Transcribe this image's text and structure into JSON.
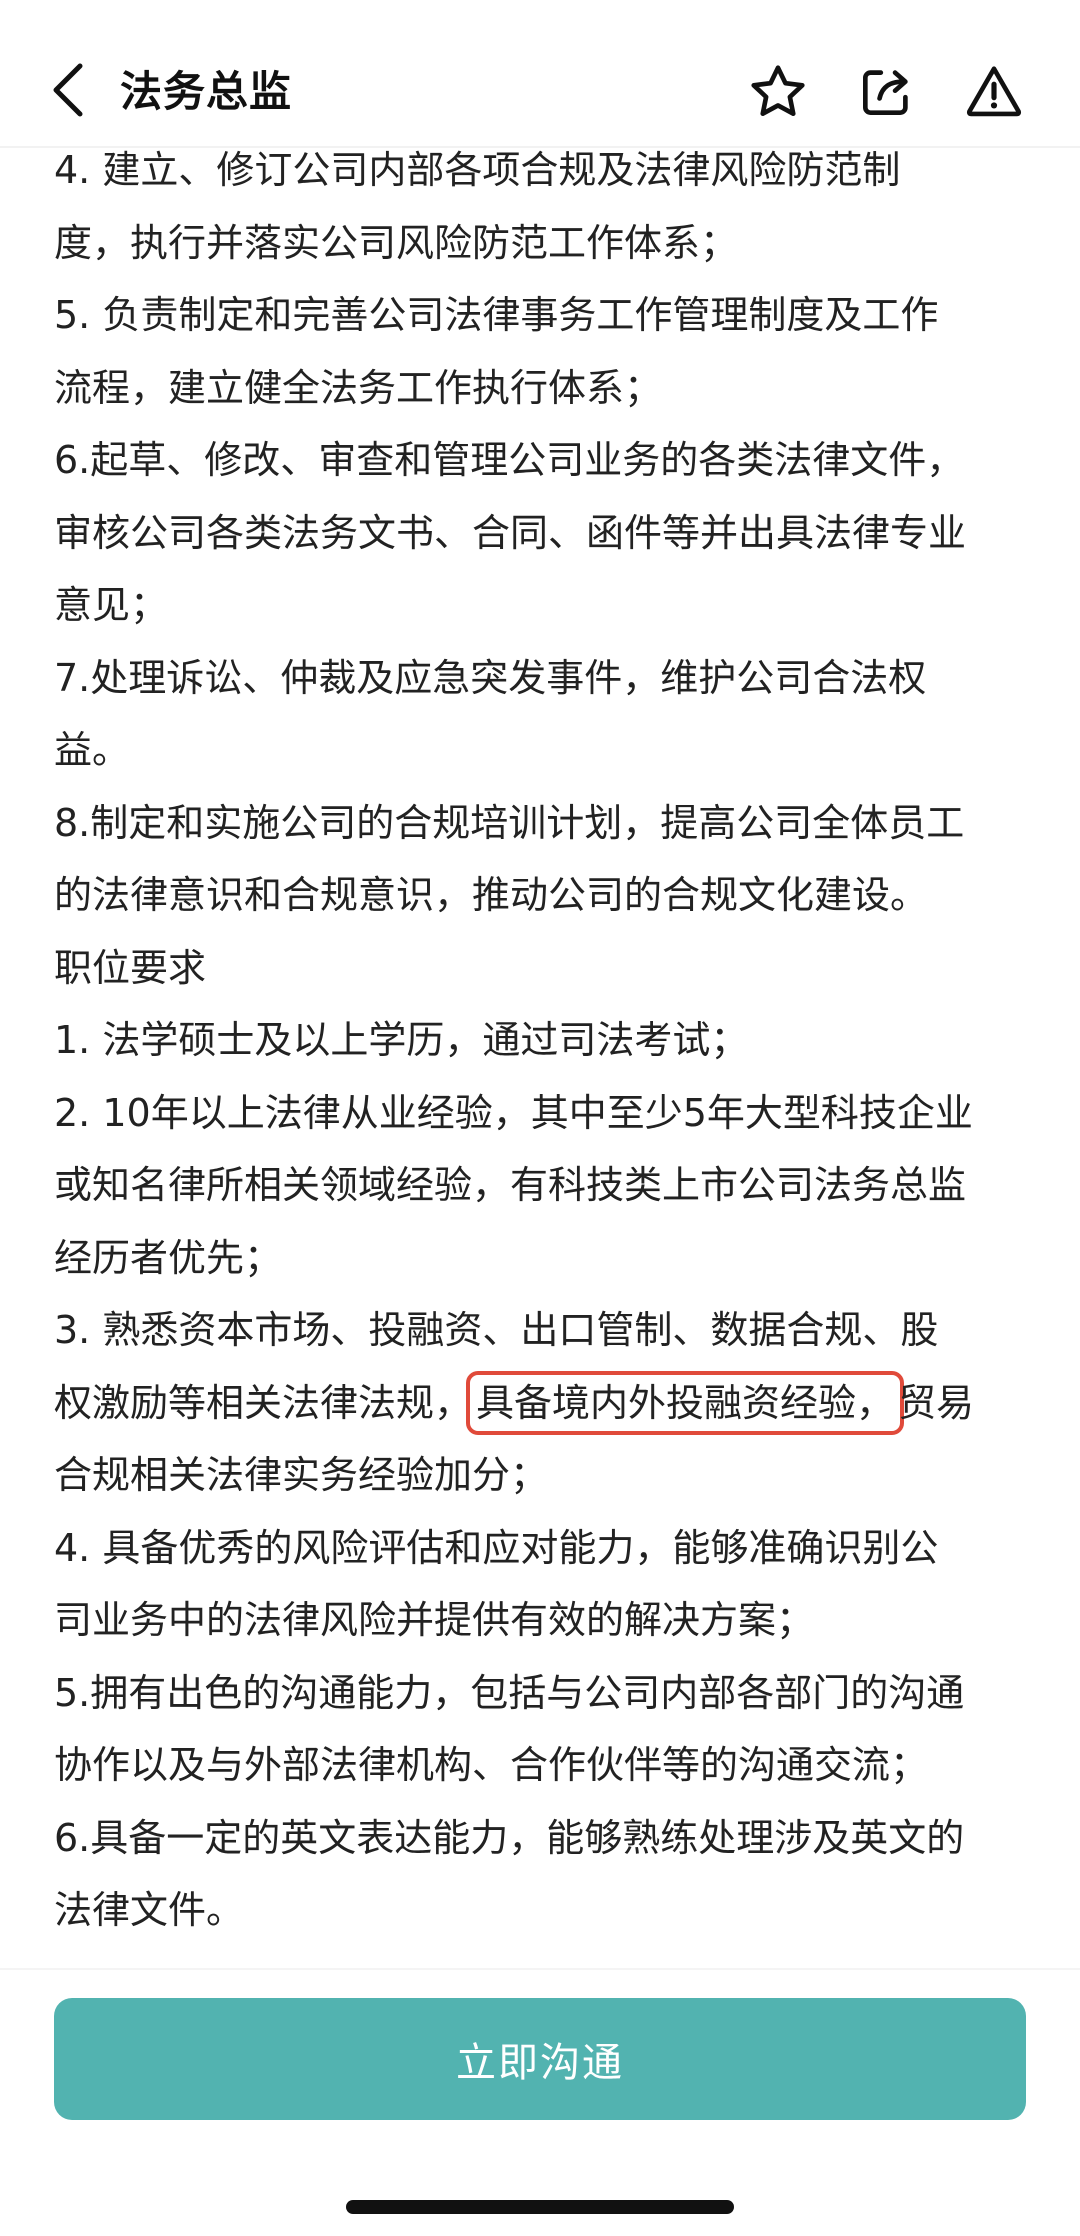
{
  "header": {
    "title": "法务总监",
    "back_icon": "chevron-left-icon",
    "actions": [
      "star-icon",
      "share-icon",
      "report-icon"
    ]
  },
  "content": {
    "lines": [
      "4. 建立、修订公司内部各项合规及法律风险防范制",
      "度，执行并落实公司风险防范工作体系；",
      "5. 负责制定和完善公司法律事务工作管理制度及工作",
      "流程，建立健全法务工作执行体系；",
      "6.起草、修改、审查和管理公司业务的各类法律文件，",
      "审核公司各类法务文书、合同、函件等并出具法律专业",
      "意见；",
      "7.处理诉讼、仲裁及应急突发事件，维护公司合法权",
      "益。",
      "8.制定和实施公司的合规培训计划，提高公司全体员工",
      "的法律意识和合规意识，推动公司的合规文化建设。",
      "职位要求",
      "1. 法学硕士及以上学历，通过司法考试；",
      "2. 10年以上法律从业经验，其中至少5年大型科技企业",
      "或知名律所相关领域经验，有科技类上市公司法务总监",
      "经历者优先；",
      "3. 熟悉资本市场、投融资、出口管制、数据合规、股"
    ],
    "highlight_line": {
      "before": "权激励等相关法律法规，",
      "highlight": "具备境内外投融资经验，",
      "after": "贸易"
    },
    "lines_after": [
      "合规相关法律实务经验加分；",
      "4. 具备优秀的风险评估和应对能力，能够准确识别公",
      "司业务中的法律风险并提供有效的解决方案；",
      "5.拥有出色的沟通能力，包括与公司内部各部门的沟通",
      "协作以及与外部法律机构、合作伙伴等的沟通交流；",
      "6.具备一定的英文表达能力，能够熟练处理涉及英文的",
      "法律文件。"
    ]
  },
  "footer": {
    "button_label": "立即沟通"
  },
  "colors": {
    "accent": "#52b3b0",
    "highlight_border": "#e04a3a"
  }
}
